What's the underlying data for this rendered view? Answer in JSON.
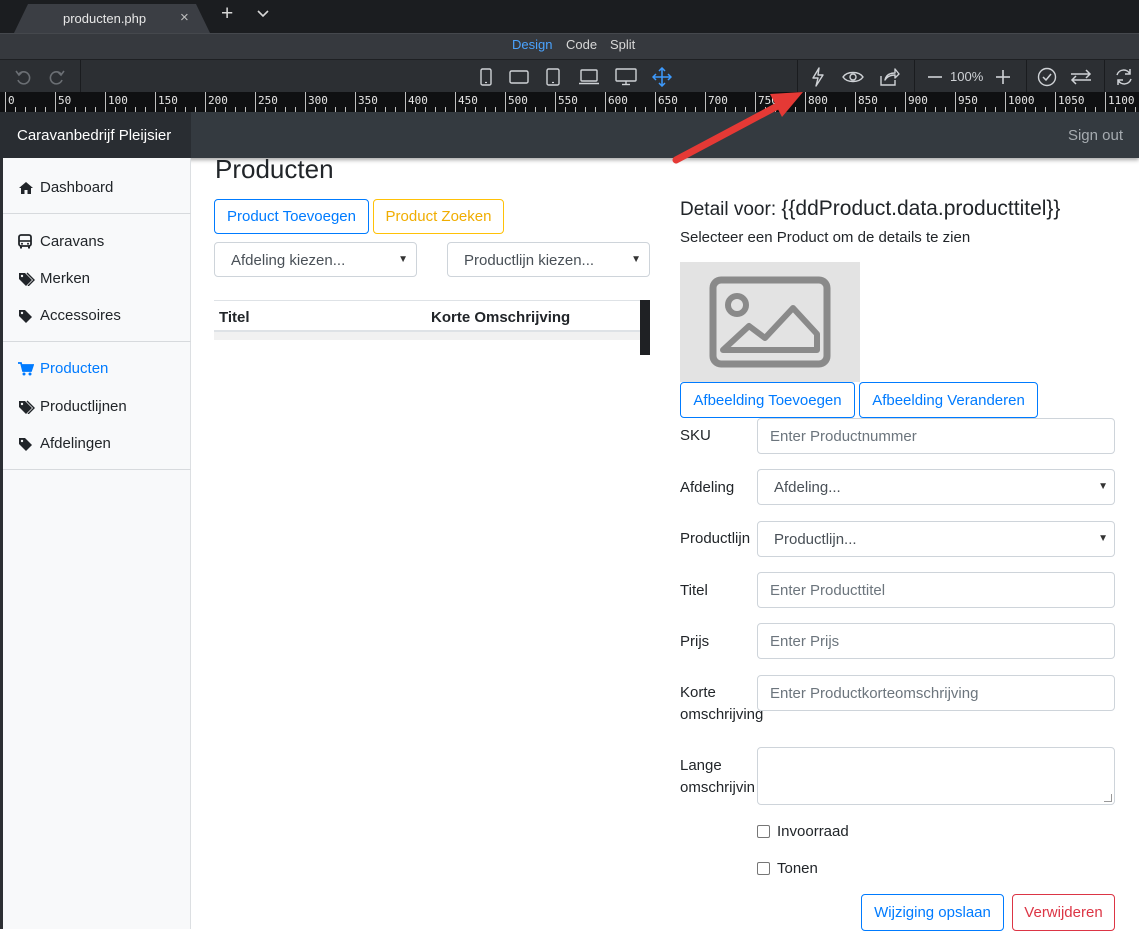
{
  "editor": {
    "tab": {
      "label": "producten.php",
      "close": "×",
      "new": "+",
      "menu": "⌄"
    },
    "view_modes": {
      "design": "Design",
      "code": "Code",
      "split": "Split"
    },
    "toolbar": {
      "zoom": "100%"
    },
    "ruler_labels": [
      "0",
      "50",
      "100",
      "150",
      "200",
      "250",
      "300",
      "350",
      "400",
      "450",
      "500",
      "550",
      "600",
      "650",
      "700",
      "750",
      "800",
      "850",
      "900",
      "950",
      "1000",
      "1050",
      "1100"
    ]
  },
  "navbar": {
    "brand": "Caravanbedrijf Pleijsier",
    "signout": "Sign out"
  },
  "sidebar": {
    "items": [
      {
        "label": "Dashboard",
        "icon": "home-icon"
      },
      {
        "label": "Caravans",
        "icon": "bus-icon"
      },
      {
        "label": "Merken",
        "icon": "tags-icon"
      },
      {
        "label": "Accessoires",
        "icon": "tag-icon"
      },
      {
        "label": "Producten",
        "icon": "cart-icon",
        "active": true
      },
      {
        "label": "Productlijnen",
        "icon": "tags-icon"
      },
      {
        "label": "Afdelingen",
        "icon": "tag-icon"
      }
    ]
  },
  "main": {
    "title": "Producten",
    "add_button": "Product Toevoegen",
    "search_button": "Product Zoeken",
    "afdeling_select": "Afdeling kiezen...",
    "productlijn_select": "Productlijn kiezen...",
    "table": {
      "columns": [
        "Titel",
        "Korte Omschrijving"
      ],
      "rows": []
    }
  },
  "detail": {
    "title_prefix": "Detail voor:",
    "title_binding": "{{ddProduct.data.producttitel}}",
    "subtitle": "Selecteer een Product om de details te zien",
    "add_image": "Afbeelding Toevoegen",
    "change_image": "Afbeelding Veranderen",
    "fields": {
      "sku": {
        "label": "SKU",
        "placeholder": "Enter Productnummer"
      },
      "afdeling": {
        "label": "Afdeling",
        "value": "Afdeling..."
      },
      "productlijn": {
        "label": "Productlijn",
        "value": "Productlijn..."
      },
      "titel": {
        "label": "Titel",
        "placeholder": "Enter Producttitel"
      },
      "prijs": {
        "label": "Prijs",
        "placeholder": "Enter Prijs"
      },
      "korte": {
        "label_1": "Korte",
        "label_2": "omschrijving",
        "placeholder": "Enter Productkorteomschrijving"
      },
      "lange": {
        "label_1": "Lange",
        "label_2": "omschrijvin"
      }
    },
    "checkboxes": {
      "invoorraad": "Invoorraad",
      "tonen": "Tonen"
    },
    "save_button": "Wijziging opslaan",
    "delete_button": "Verwijderen"
  },
  "colors": {
    "accent": "#007bff",
    "warning": "#ffc107",
    "danger": "#dc3545",
    "annotation_arrow": "#e53935"
  }
}
